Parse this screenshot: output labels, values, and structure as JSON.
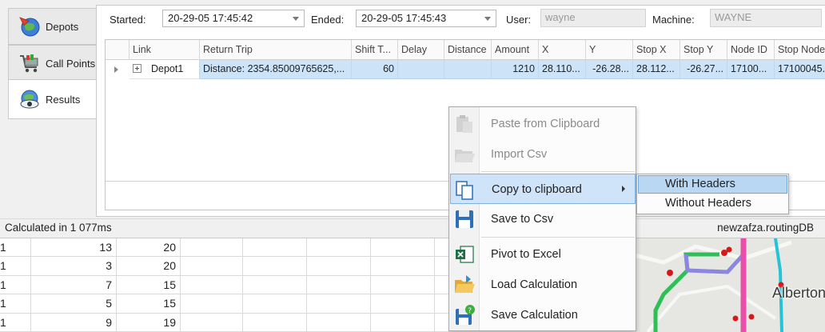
{
  "tabs": [
    {
      "label": "Depots",
      "icon": "globe-icon"
    },
    {
      "label": "Call Points",
      "icon": "shopping-cart-icon"
    },
    {
      "label": "Results",
      "icon": "eye-globe-icon"
    }
  ],
  "filters": {
    "started_label": "Started:",
    "started_value": "20-29-05 17:45:42",
    "ended_label": "Ended:",
    "ended_value": "20-29-05 17:45:43",
    "user_label": "User:",
    "user_value": "wayne",
    "machine_label": "Machine:",
    "machine_value": "WAYNE"
  },
  "grid": {
    "columns": [
      "Link",
      "Return Trip",
      "Shift T...",
      "Delay",
      "Distance",
      "Amount",
      "X",
      "Y",
      "Stop X",
      "Stop Y",
      "Node ID",
      "Stop Node"
    ],
    "row": {
      "link": "Depot1",
      "return_trip": "Distance: 2354.85009765625,...",
      "shift_time": "60",
      "delay": "",
      "distance": "",
      "amount": "1210",
      "x": "28.110...",
      "y": "-26.28...",
      "stop_x": "28.112...",
      "stop_y": "-26.27...",
      "node_id": "17100...",
      "stop_node": "17100045..."
    }
  },
  "status": {
    "left": "Calculated in 1 077ms",
    "right": "newzafza.routingDB"
  },
  "sheet": {
    "rows": [
      {
        "a": "1",
        "b": "13",
        "c": "20"
      },
      {
        "a": "1",
        "b": "3",
        "c": "20"
      },
      {
        "a": "1",
        "b": "7",
        "c": "15"
      },
      {
        "a": "1",
        "b": "5",
        "c": "15"
      },
      {
        "a": "1",
        "b": "9",
        "c": "19"
      }
    ]
  },
  "map": {
    "label": "Alberton"
  },
  "context_menu": {
    "items": [
      {
        "label": "Paste from Clipboard",
        "icon": "clipboard-paste-icon",
        "enabled": false
      },
      {
        "label": "Import Csv",
        "icon": "folder-open-icon",
        "enabled": false
      },
      {
        "label": "Copy to clipboard",
        "icon": "copy-icon",
        "enabled": true,
        "submenu": true
      },
      {
        "label": "Save to Csv",
        "icon": "save-disk-icon",
        "enabled": true
      },
      {
        "label": "Pivot to Excel",
        "icon": "excel-icon",
        "enabled": true
      },
      {
        "label": "Load Calculation",
        "icon": "folder-load-icon",
        "enabled": true
      },
      {
        "label": "Save Calculation",
        "icon": "save-help-icon",
        "enabled": true
      }
    ],
    "submenu": [
      "With Headers",
      "Without Headers"
    ]
  },
  "colors": {
    "selection": "#cde3f7",
    "menu_hover": "#cfe4f8",
    "submenu_hover": "#b9d7f3"
  }
}
